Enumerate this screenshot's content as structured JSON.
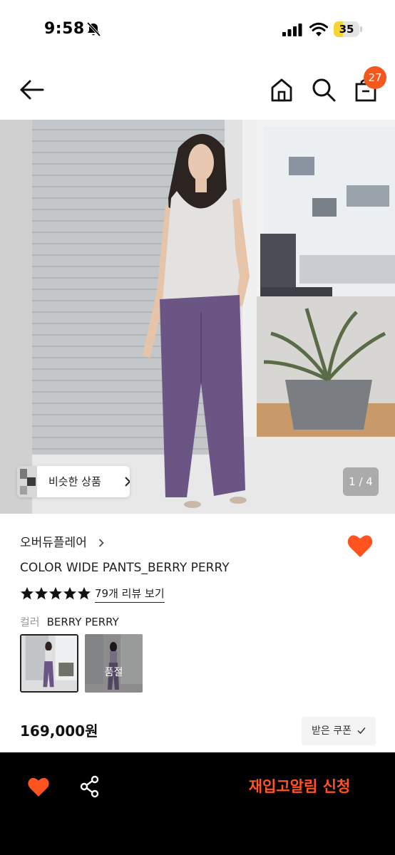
{
  "status_bar": {
    "time": "9:58",
    "battery_level": "35",
    "battery_fraction": 0.35
  },
  "header": {
    "cart_count": "27"
  },
  "gallery": {
    "similar_label": "비슷한 상품",
    "page_indicator": "1 / 4"
  },
  "product": {
    "brand": "오버듀플레어",
    "name": "COLOR WIDE PANTS_BERRY PERRY",
    "rating_stars": 5,
    "review_link": "79개 리뷰 보기",
    "color_label": "컬러",
    "color_value": "BERRY PERRY",
    "variants": [
      {
        "selected": true,
        "soldout_label": ""
      },
      {
        "selected": false,
        "soldout_label": "품절"
      }
    ],
    "price": "169,000원",
    "coupon_label": "받은 쿠폰"
  },
  "bottom_bar": {
    "restock_label": "재입고알림 신청"
  },
  "colors": {
    "accent": "#F5581E",
    "heart": "#FF5320",
    "bottom_bar_bg": "#000000",
    "pants": "#6B5585"
  }
}
